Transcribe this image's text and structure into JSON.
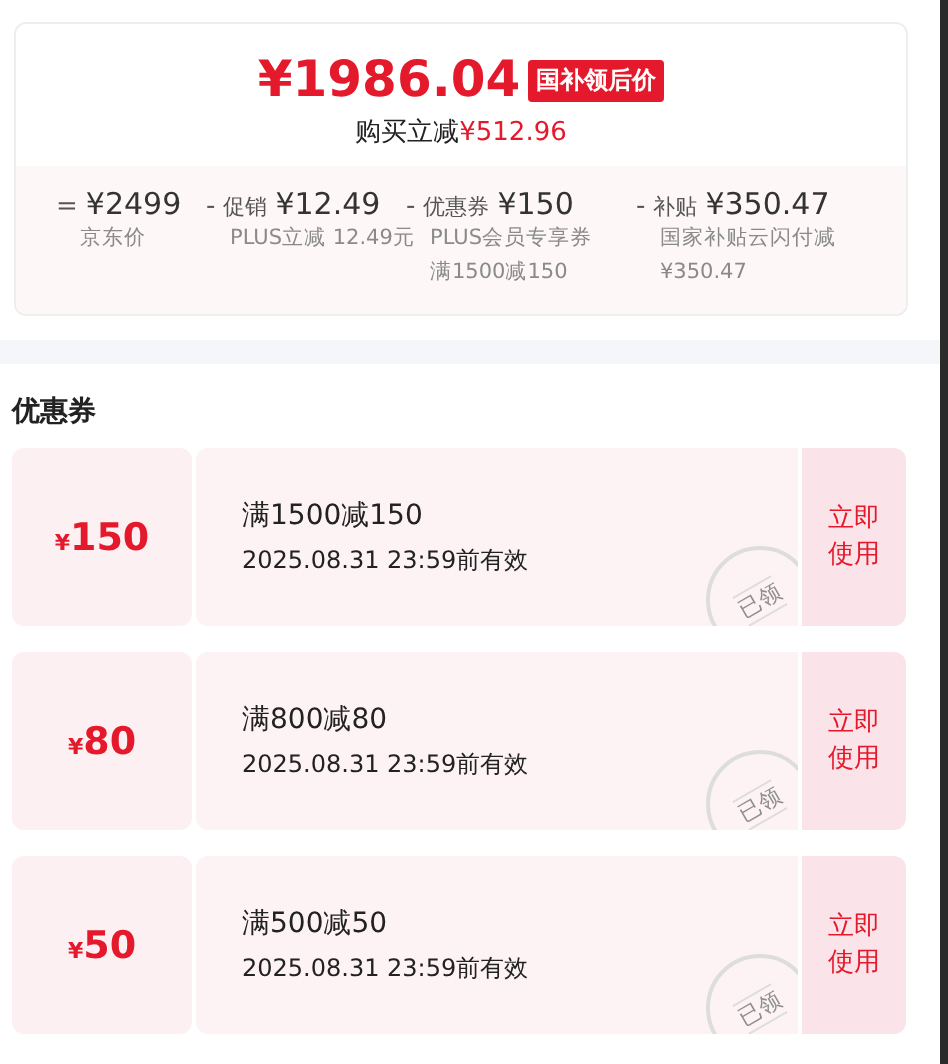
{
  "price_card": {
    "final_price": "¥1986.04",
    "badge": "国补领后价",
    "saving_label": "购买立减",
    "saving_amount": "¥512.96",
    "breakdown": [
      {
        "operator": "=",
        "amount": "¥2499",
        "notes": [
          "京东价"
        ]
      },
      {
        "operator": "-",
        "label": "促销",
        "amount": "¥12.49",
        "notes": [
          "PLUS立减 12.49元"
        ]
      },
      {
        "operator": "-",
        "label": "优惠券",
        "amount": "¥150",
        "notes": [
          "PLUS会员专享券",
          "满1500减150"
        ]
      },
      {
        "operator": "-",
        "label": "补贴",
        "amount": "¥350.47",
        "notes": [
          "国家补贴云闪付减",
          "¥350.47"
        ]
      }
    ]
  },
  "coupons_section": {
    "title": "优惠券",
    "coupons": [
      {
        "currency": "¥",
        "value": "150",
        "condition": "满1500减150",
        "validity": "2025.08.31 23:59前有效",
        "claimed": true,
        "stamp": "已领",
        "action": "立即使用"
      },
      {
        "currency": "¥",
        "value": "80",
        "condition": "满800减80",
        "validity": "2025.08.31 23:59前有效",
        "claimed": true,
        "stamp": "已领",
        "action": "立即使用"
      },
      {
        "currency": "¥",
        "value": "50",
        "condition": "满500减50",
        "validity": "2025.08.31 23:59前有效",
        "claimed": true,
        "stamp": "已领",
        "action": "立即使用"
      }
    ]
  }
}
